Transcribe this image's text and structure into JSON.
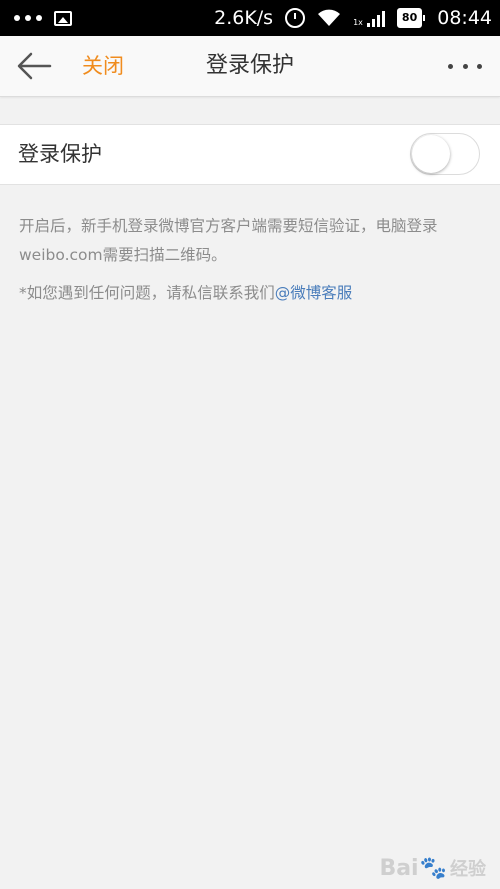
{
  "status_bar": {
    "net_speed": "2.6K/s",
    "signal_label": "1x",
    "battery": "80",
    "time": "08:44"
  },
  "navbar": {
    "close_label": "关闭",
    "title": "登录保护"
  },
  "setting": {
    "label": "登录保护",
    "enabled": false
  },
  "description": {
    "main": "开启后，新手机登录微博官方客户端需要短信验证，电脑登录weibo.com需要扫描二维码。",
    "note_prefix": "*如您遇到任何问题，请私信联系我们",
    "note_link": "@微博客服"
  },
  "watermark": {
    "left": "Bai",
    "right": "经验"
  },
  "colors": {
    "accent": "#f08c1e",
    "link": "#4a7dbb",
    "background": "#f2f2f2"
  },
  "icons": [
    "more-dots-icon",
    "image-icon",
    "alarm-icon",
    "wifi-icon",
    "signal-icon",
    "battery-icon",
    "back-arrow-icon",
    "more-icon"
  ]
}
